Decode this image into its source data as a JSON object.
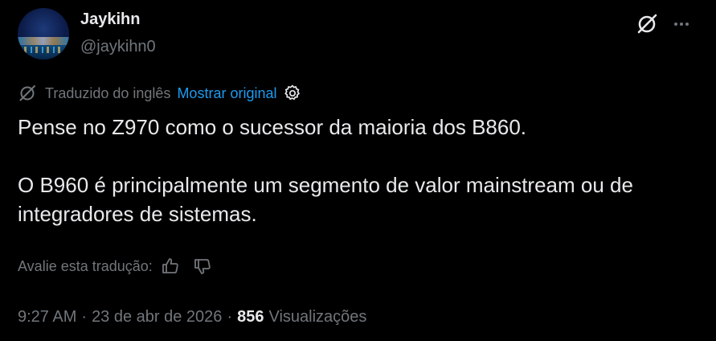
{
  "author": {
    "name": "Jaykihn",
    "handle": "@jaykihn0"
  },
  "icons": {
    "avatar": "profile-photo-night-harbor",
    "grok": "grok-slash-icon",
    "more": "more-horizontal-icon",
    "translate": "translate-slash-icon",
    "settings": "gear-icon",
    "like": "thumbs-up-icon",
    "dislike": "thumbs-down-icon"
  },
  "translation": {
    "label": "Traduzido do inglês",
    "show_original": "Mostrar original"
  },
  "tweet": {
    "line1": "Pense no Z970 como o sucessor da maioria dos B860.",
    "line2": "O B960 é principalmente um segmento de valor mainstream ou de integradores de sistemas."
  },
  "rating": {
    "prompt": "Avalie esta tradução:"
  },
  "meta": {
    "time": "9:27 AM",
    "separator": "·",
    "date": "23 de abr de 2026",
    "views_count": "856",
    "views_label": "Visualizações"
  },
  "colors": {
    "background": "#000000",
    "text": "#e7e9ea",
    "muted": "#71767b",
    "link": "#1d9bf0"
  }
}
